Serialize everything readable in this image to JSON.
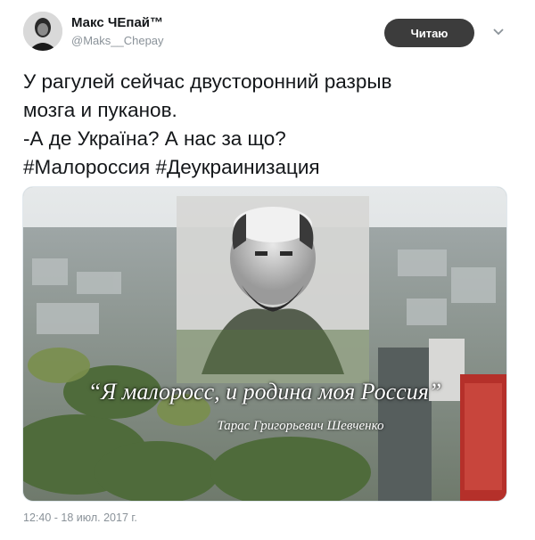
{
  "tweet": {
    "author_name": "Макс ЧЕпай™",
    "author_handle": "@Maks__Chepay",
    "follow_label": "Читаю",
    "text_lines": [
      "У рагулей сейчас двусторонний разрыв",
      "мозга и пуканов.",
      "-А де Україна? А нас за що?",
      "#Малороссия #Деукраинизация"
    ],
    "timestamp": "12:40 - 18 июл. 2017 г."
  },
  "media": {
    "quote": "“Я малоросс, и родина моя Россия”",
    "author": "Тарас Григорьевич Шевченко"
  },
  "icons": {
    "menu": "chevron-down-icon",
    "avatar": "user-avatar"
  }
}
